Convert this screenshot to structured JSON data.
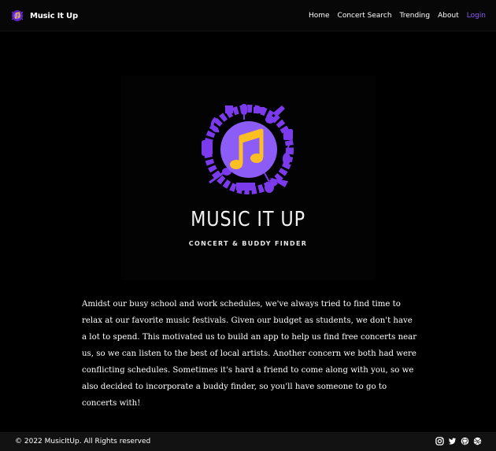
{
  "navbar": {
    "brand_name": "Music It Up",
    "links": [
      {
        "label": "Home"
      },
      {
        "label": "Concert Search"
      },
      {
        "label": "Trending"
      },
      {
        "label": "About"
      },
      {
        "label": "Login"
      }
    ]
  },
  "hero": {
    "title": "MUSIC IT UP",
    "subtitle": "CONCERT & BUDDY FINDER",
    "emblem_icon": "music-note-instruments-icon"
  },
  "about": {
    "paragraph": "Amidst our busy school and work schedules, we've always tried to find time to relax at our favorite music festivals. Given our budget as students, we don't have a lot to spend. This motivated us to build an app to help us find free concerts near us, so we can listen to the best of local artists. Another concern we both had were conflicting schedules. Sometimes it's hard a friend to come along with you, so we also decided to incorporate a buddy finder, so you'll have someone to go to concerts with!"
  },
  "footer": {
    "copyright": "© 2022 MusicItUp. All Rights reserved",
    "socials": [
      "instagram-icon",
      "twitter-icon",
      "github-icon",
      "dribbble-icon"
    ]
  },
  "colors": {
    "accent": "#8b5cf6",
    "emblem_purple": "#7c3aed",
    "note_yellow": "#fbbf24",
    "background": "#000000",
    "footer_bg": "#121212"
  }
}
